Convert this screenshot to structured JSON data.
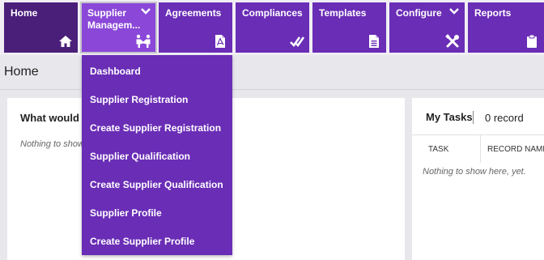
{
  "nav": {
    "home": "Home",
    "supplier_line1": "Supplier",
    "supplier_line2": "Managem...",
    "agreements": "Agreements",
    "compliances": "Compliances",
    "templates": "Templates",
    "configure": "Configure",
    "reports": "Reports"
  },
  "breadcrumb": "Home",
  "left_card": {
    "title": "What would y",
    "empty": "Nothing to show"
  },
  "tasks": {
    "title": "My Tasks",
    "count": "0 record",
    "col_task": "TASK",
    "col_record": "RECORD NAME",
    "empty": "Nothing to show here, yet."
  },
  "menu": {
    "items": [
      "Dashboard",
      "Supplier Registration",
      "Create Supplier Registration",
      "Supplier Qualification",
      "Create Supplier Qualification",
      "Supplier Profile",
      "Create Supplier Profile"
    ]
  },
  "colors": {
    "nav_purple": "#6a2db6",
    "home_purple": "#4a1f7a",
    "active_purple": "#8a47d8"
  }
}
